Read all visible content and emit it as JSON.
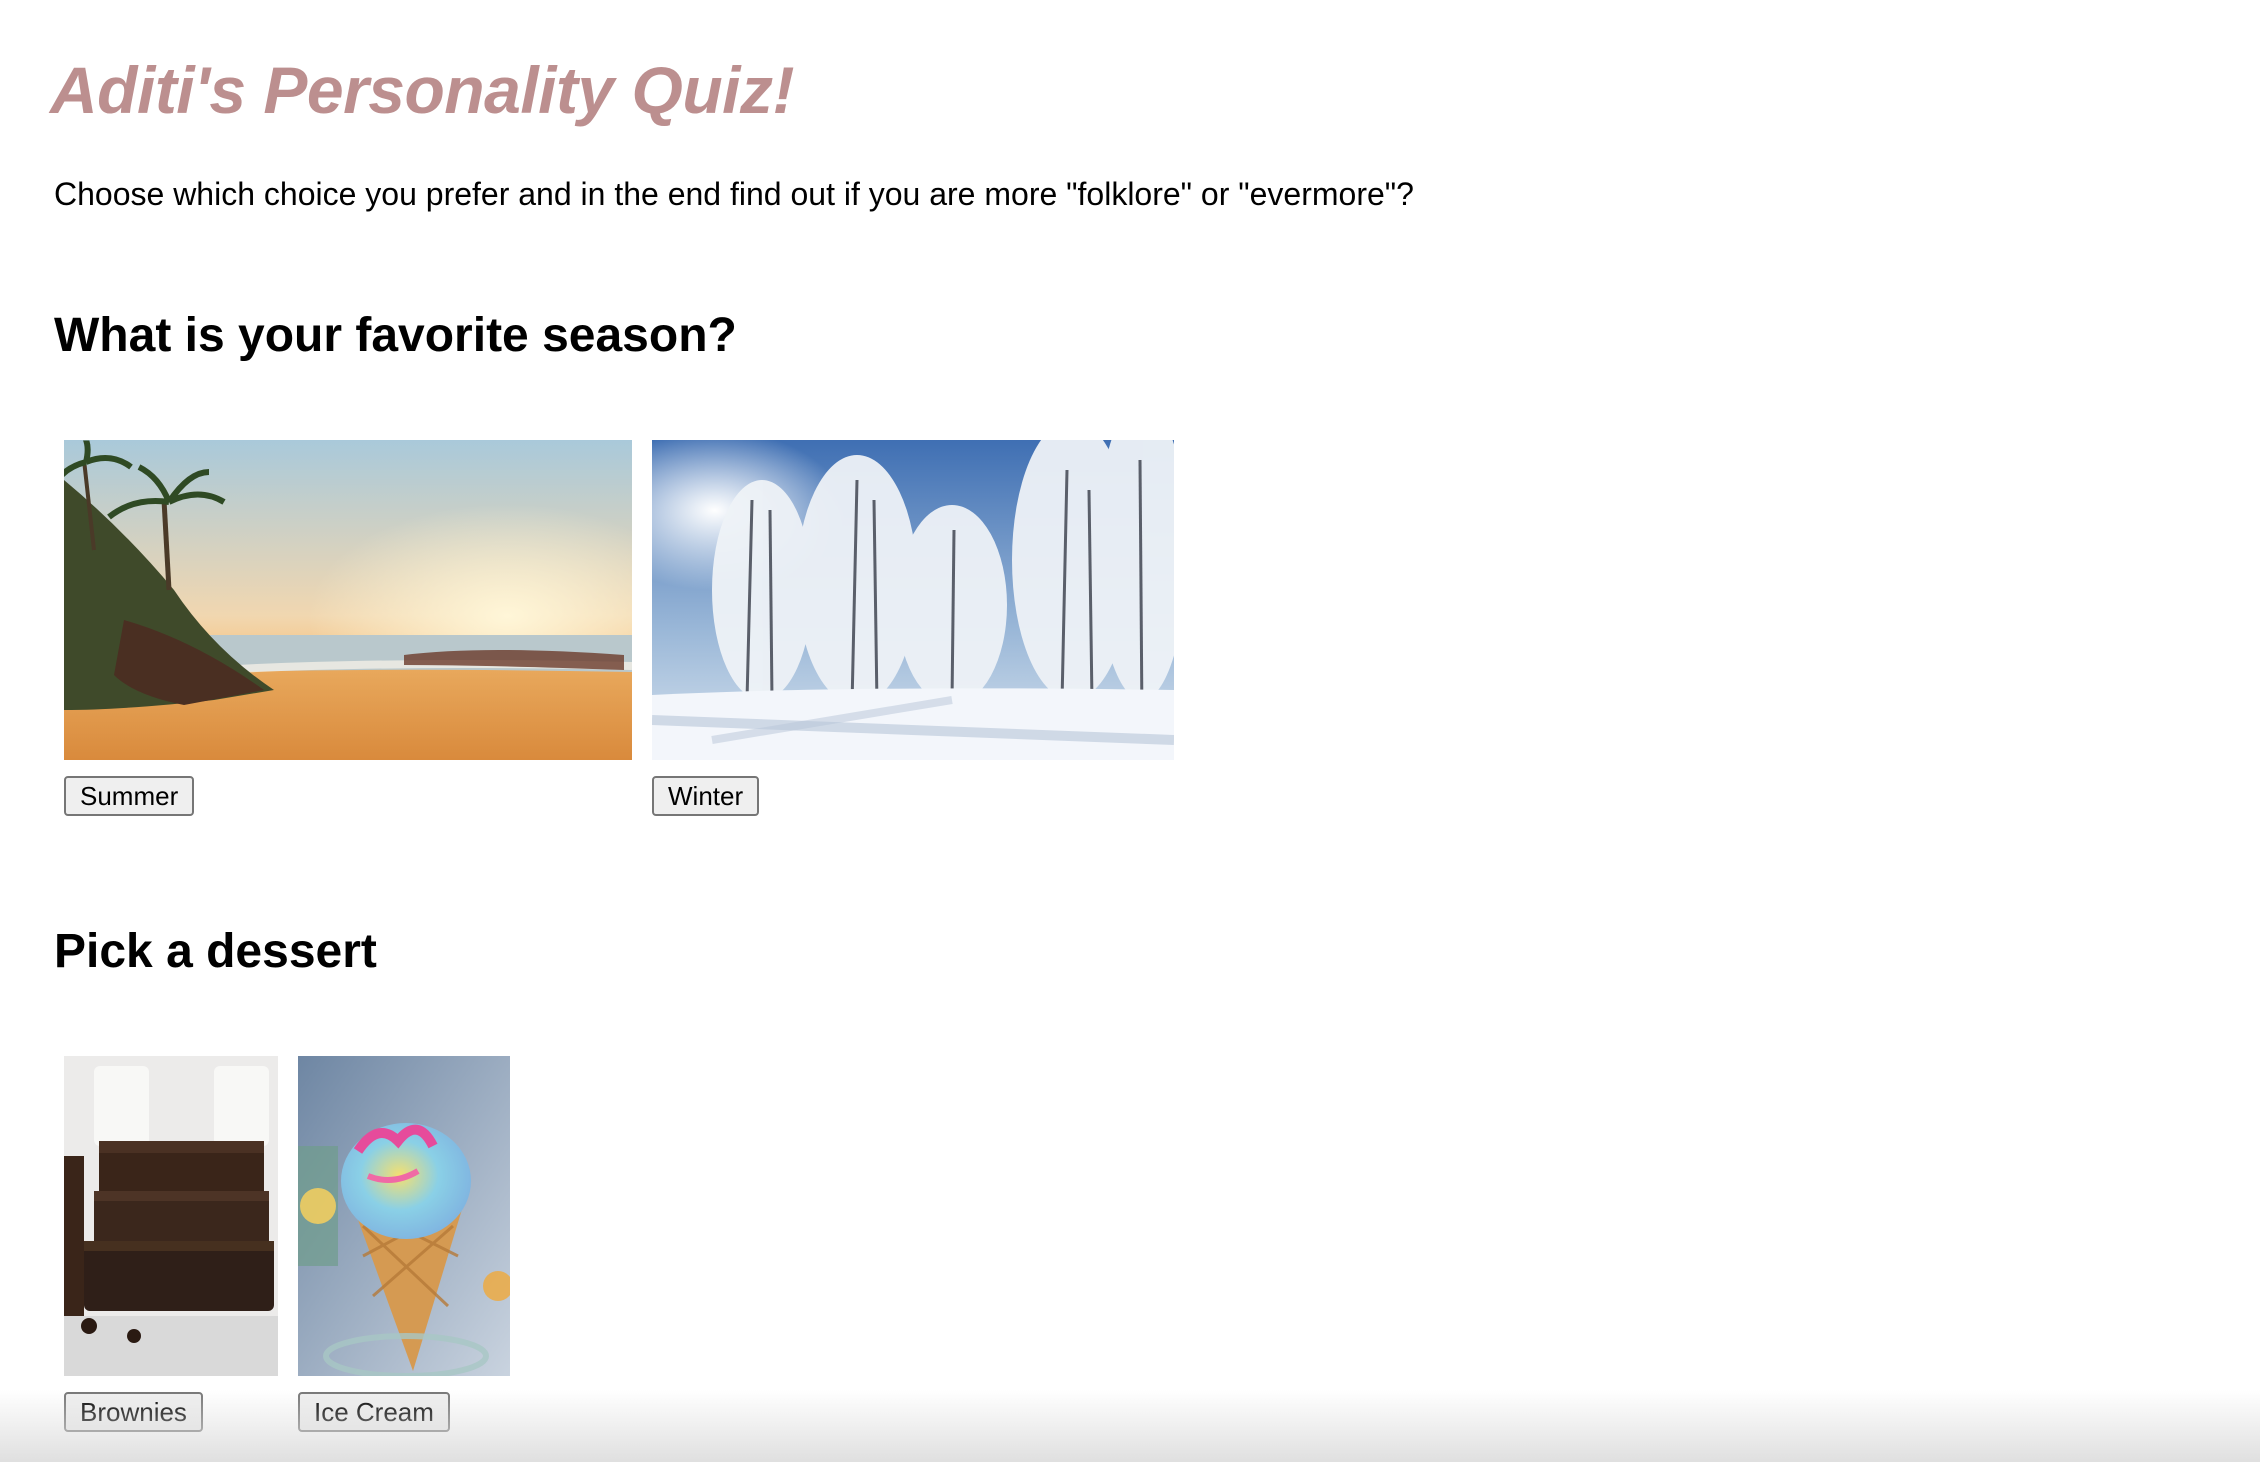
{
  "page": {
    "title": "Aditi's Personality Quiz!",
    "intro": "Choose which choice you prefer and in the end find out if you are more \"folklore\" or \"evermore\"?",
    "title_color": "#bc8f8f"
  },
  "questions": [
    {
      "prompt": "What is your favorite season?",
      "choices": [
        {
          "label": "Summer",
          "image": "summer-beach-sunset"
        },
        {
          "label": "Winter",
          "image": "snowy-forest"
        }
      ]
    },
    {
      "prompt": "Pick a dessert",
      "choices": [
        {
          "label": "Brownies",
          "image": "stacked-brownies"
        },
        {
          "label": "Ice Cream",
          "image": "rainbow-ice-cream-cone"
        }
      ]
    }
  ]
}
